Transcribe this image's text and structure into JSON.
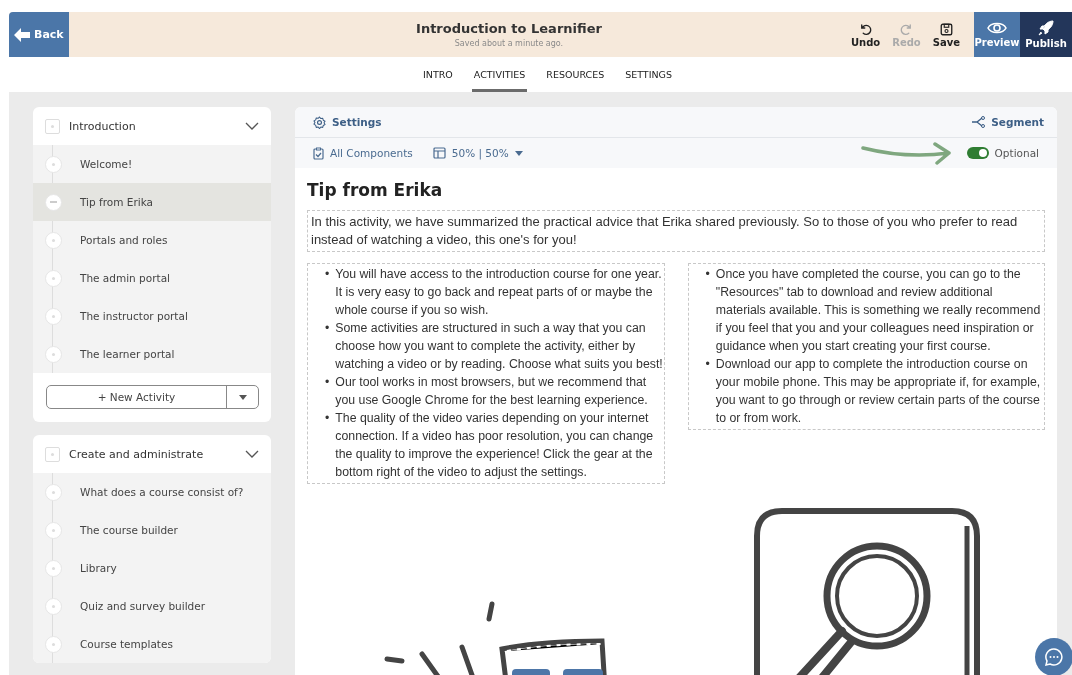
{
  "header": {
    "back": "Back",
    "title": "Introduction to Learnifier",
    "subtitle": "Saved about a minute ago.",
    "actions": [
      {
        "kind": "undo",
        "label": "Undo",
        "disabled": false
      },
      {
        "kind": "redo",
        "label": "Redo",
        "disabled": true
      },
      {
        "kind": "save",
        "label": "Save",
        "disabled": false
      }
    ],
    "preview": "Preview",
    "publish": "Publish"
  },
  "tabs": [
    {
      "label": "INTRO",
      "selected": false
    },
    {
      "label": "ACTIVITIES",
      "selected": true
    },
    {
      "label": "RESOURCES",
      "selected": false
    },
    {
      "label": "SETTINGS",
      "selected": false
    }
  ],
  "sidebar": {
    "sections": [
      {
        "title": "Introduction",
        "expanded": true,
        "items": [
          {
            "label": "Welcome!",
            "selected": false
          },
          {
            "label": "Tip from Erika",
            "selected": true
          },
          {
            "label": "Portals and roles",
            "selected": false
          },
          {
            "label": "The admin portal",
            "selected": false
          },
          {
            "label": "The instructor portal",
            "selected": false
          },
          {
            "label": "The learner portal",
            "selected": false
          }
        ],
        "new_activity": "+ New Activity"
      },
      {
        "title": "Create and administrate",
        "expanded": true,
        "items": [
          {
            "label": "What does a course consist of?",
            "selected": false
          },
          {
            "label": "The course builder",
            "selected": false
          },
          {
            "label": "Library",
            "selected": false
          },
          {
            "label": "Quiz and survey builder",
            "selected": false
          },
          {
            "label": "Course templates",
            "selected": false
          }
        ]
      }
    ]
  },
  "panel": {
    "settings": "Settings",
    "segment": "Segment",
    "components": "All Components",
    "layout": "50% | 50%",
    "optional": {
      "label": "Optional",
      "on": true
    },
    "title": "Tip from Erika",
    "intro": "In this activity, we have summarized the practical advice that Erika shared previously. So to those of you who prefer to read instead of watching a video, this one's for you!",
    "bullet_marker": "•",
    "columns": [
      [
        "You will have access to the introduction course for one year. It is very easy to go back and repeat parts of or maybe the whole course if you so wish.",
        "Some activities are structured in such a way that you can choose how you want to complete the activity, either by watching a video or by reading. Choose what suits you best!",
        "Our tool works in most browsers, but we recommend that you use Google Chrome for the best learning experience.",
        "The quality of the video varies depending on your internet connection. If a video has poor resolution, you can change the quality to improve the experience! Click the gear at the bottom right of the video to adjust the settings."
      ],
      [
        "Once you have completed the course, you can go to the \"Resources\" tab to download and review additional materials available. This is something we really recommend if you feel that you and your colleagues need inspiration or guidance when you start creating your first course.",
        "Download our app to complete the introduction course on your mobile phone. This may be appropriate if, for example, you want to go through or review certain parts of the course to or from work."
      ]
    ]
  }
}
